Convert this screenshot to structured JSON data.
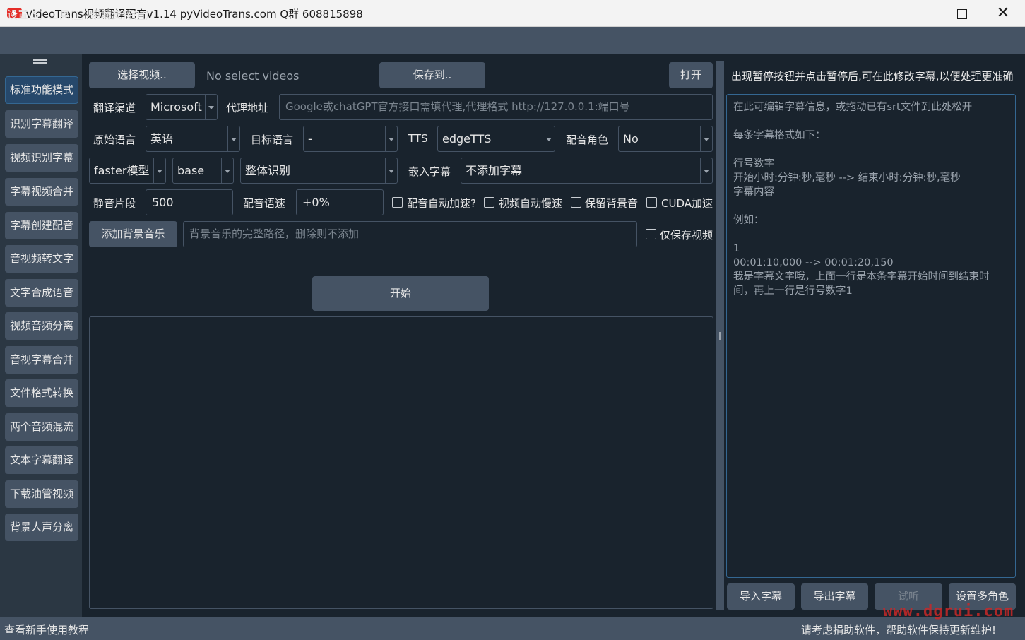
{
  "window": {
    "title": "VideoTrans视频翻译配音v1.14  pyVideoTrans.com     Q群 608815898",
    "close_glyph": "✕"
  },
  "menu": [
    {
      "label": "设置(",
      "key": "S",
      "suffix": ")"
    },
    {
      "label": "工具(",
      "key": "T",
      "suffix": ")"
    },
    {
      "label": "帮助支持(",
      "key": "H",
      "suffix": ")"
    }
  ],
  "sidebar": {
    "items": [
      "标准功能模式",
      "识别字幕翻译",
      "视频识别字幕",
      "字幕视频合并",
      "字幕创建配音",
      "音视频转文字",
      "文字合成语音",
      "视频音频分离",
      "音视字幕合并",
      "文件格式转换",
      "两个音频混流",
      "文本字幕翻译",
      "下载油管视频",
      "背景人声分离"
    ],
    "active_index": 0
  },
  "toolbar": {
    "select_video": "选择视频..",
    "no_video": "No select videos",
    "save_to": "保存到..",
    "open": "打开"
  },
  "row1": {
    "translate_label": "翻译渠道",
    "translate_value": "Microsoft",
    "proxy_label": "代理地址",
    "proxy_placeholder": "Google或chatGPT官方接口需填代理,代理格式 http://127.0.0.1:端口号"
  },
  "row2": {
    "source_label": "原始语言",
    "source_value": "英语",
    "target_label": "目标语言",
    "target_value": "-",
    "tts_label": "TTS",
    "tts_value": "edgeTTS",
    "role_label": "配音角色",
    "role_value": "No"
  },
  "row3": {
    "model_type": "faster模型",
    "model_size": "base",
    "recog_mode": "整体识别",
    "embed_label": "嵌入字幕",
    "embed_value": "不添加字幕"
  },
  "row4": {
    "silence_label": "静音片段",
    "silence_value": "500",
    "speed_label": "配音语速",
    "speed_value": "+0%",
    "check_auto_speed": "配音自动加速?",
    "check_video_slow": "视频自动慢速",
    "check_keep_bg": "保留背景音",
    "check_cuda": "CUDA加速"
  },
  "row5": {
    "add_bgm": "添加背景音乐",
    "bgm_placeholder": "背景音乐的完整路径，删除则不添加",
    "check_only_video": "仅保存视频"
  },
  "start_button": "开始",
  "right_panel": {
    "hint": "出现暂停按钮并点击暂停后,可在此修改字幕,以便处理更准确",
    "editor_lines": [
      "在此可编辑字幕信息，或拖动已有srt文件到此处松开",
      "",
      "每条字幕格式如下：",
      "",
      "行号数字",
      "开始小时:分钟:秒,毫秒 --> 结束小时:分钟:秒,毫秒",
      "字幕内容",
      "",
      "例如：",
      "",
      "1",
      "00:01:10,000 --> 00:01:20,150",
      "我是字幕文字哦，上面一行是本条字幕开始时间到结束时间，再上一行是行号数字1"
    ],
    "import_sub": "导入字幕",
    "export_sub": "导出字幕",
    "try_listen": "试听",
    "multi_role": "设置多角色"
  },
  "status": {
    "left": "查看新手使用教程",
    "right": "请考虑捐助软件，帮助软件保持更新维护!"
  },
  "watermark": "www.dgrui.com"
}
